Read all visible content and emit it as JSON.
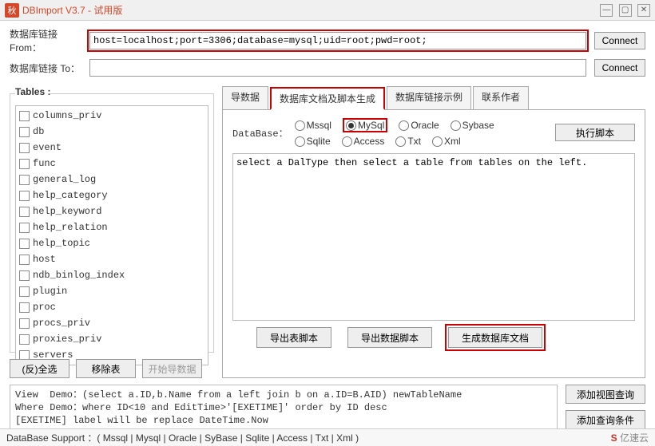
{
  "window": {
    "icon_text": "秋",
    "title": "DBImport V3.7 - 试用版"
  },
  "connection": {
    "from_label": "数据库链接 From：",
    "from_value": "host=localhost;port=3306;database=mysql;uid=root;pwd=root;",
    "to_label": "数据库链接 To：",
    "to_value": "",
    "connect_label": "Connect"
  },
  "tables": {
    "legend": "Tables :",
    "items": [
      "columns_priv",
      "db",
      "event",
      "func",
      "general_log",
      "help_category",
      "help_keyword",
      "help_relation",
      "help_topic",
      "host",
      "ndb_binlog_index",
      "plugin",
      "proc",
      "procs_priv",
      "proxies_priv",
      "servers"
    ],
    "buttons": {
      "toggle_all": "(反)全选",
      "remove": "移除表",
      "start_import": "开始导数据"
    }
  },
  "tabs": {
    "items": [
      "导数据",
      "数据库文档及脚本生成",
      "数据库链接示例",
      "联系作者"
    ],
    "active_index": 1
  },
  "database_row": {
    "label": "DataBase：",
    "row1": [
      "Mssql",
      "MySql",
      "Oracle",
      "Sybase"
    ],
    "row2": [
      "Sqlite",
      "Access",
      "Txt",
      "Xml"
    ],
    "selected": "MySql",
    "execute_label": "执行脚本"
  },
  "sql_area": "select a DalType then select a table from tables on the left.",
  "gen_buttons": {
    "table": "导出表脚本",
    "data": "导出数据脚本",
    "doc": "生成数据库文档"
  },
  "demo_text": "View  Demo：(select a.ID,b.Name from a left join b on a.ID=B.AID) newTableName\nWhere Demo：where ID<10 and EditTime>'[EXETIME]' order by ID desc\n[EXETIME] label will be replace DateTime.Now",
  "side_buttons": {
    "add_view": "添加视图查询",
    "add_where": "添加查询条件"
  },
  "statusbar_text": "DataBase Support ：( Mssql | Mysql | Oracle | SyBase | Sqlite | Access | Txt | Xml )",
  "brand": {
    "logo": "S",
    "name": "亿速云"
  }
}
